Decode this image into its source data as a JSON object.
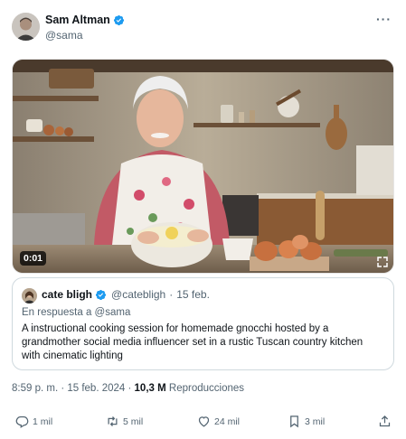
{
  "author": {
    "display_name": "Sam Altman",
    "handle": "@sama",
    "verified_icon": "verified-badge-icon"
  },
  "media": {
    "duration": "0:01"
  },
  "quoted_post": {
    "display_name": "cate bligh",
    "handle": "@catebligh",
    "separator": "·",
    "date": "15 feb.",
    "reply_label": "En respuesta a @sama",
    "text": "A instructional cooking session for homemade gnocchi hosted by a grandmother social media influencer set in a rustic Tuscan country kitchen with cinematic lighting"
  },
  "meta": {
    "time_date": "8:59 p. m. · 15 feb. 2024 · ",
    "views_count": "10,3 M",
    "views_label": " Reproducciones"
  },
  "actions": {
    "replies": "1 mil",
    "reposts": "5 mil",
    "likes": "24 mil",
    "bookmarks": "3 mil"
  },
  "colors": {
    "verified_blue": "#1d9bf0",
    "secondary_text": "#536471",
    "border": "#cfd9de"
  }
}
